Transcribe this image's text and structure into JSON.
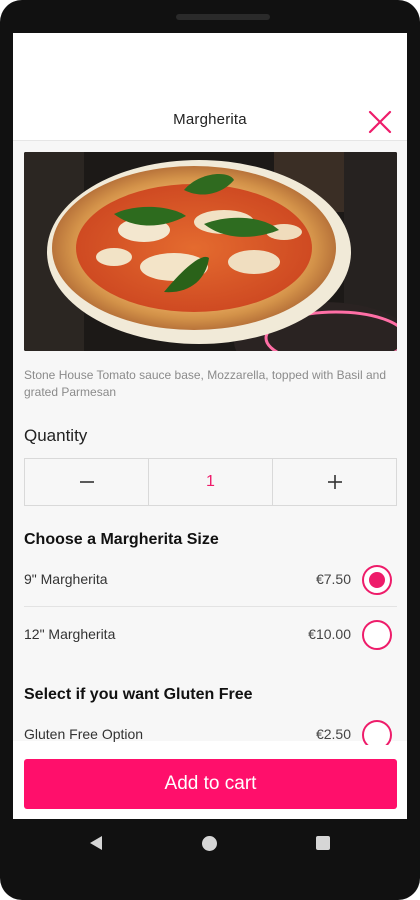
{
  "header": {
    "title": "Margherita",
    "close_icon": "close-icon"
  },
  "product": {
    "image_name": "margherita-pizza-photo",
    "description": "Stone House Tomato sauce base, Mozzarella, topped with Basil and grated Parmesan"
  },
  "quantity": {
    "label": "Quantity",
    "value": "1",
    "decrement_icon": "minus-icon",
    "increment_icon": "plus-icon"
  },
  "size_group": {
    "title": "Choose a Margherita Size",
    "options": [
      {
        "label": "9\" Margherita",
        "price": "€7.50",
        "selected": true
      },
      {
        "label": "12\" Margherita",
        "price": "€10.00",
        "selected": false
      }
    ]
  },
  "gluten_group": {
    "title": "Select if you want Gluten Free",
    "options": [
      {
        "label": "Gluten Free Option",
        "price": "€2.50",
        "selected": false
      }
    ]
  },
  "cart": {
    "button_label": "Add to cart"
  },
  "navigation": {
    "back_icon": "back-triangle-icon",
    "home_icon": "home-circle-icon",
    "recent_icon": "recent-apps-square-icon"
  },
  "colors": {
    "accent": "#ff0f6b",
    "radio": "#ee1c6a"
  }
}
